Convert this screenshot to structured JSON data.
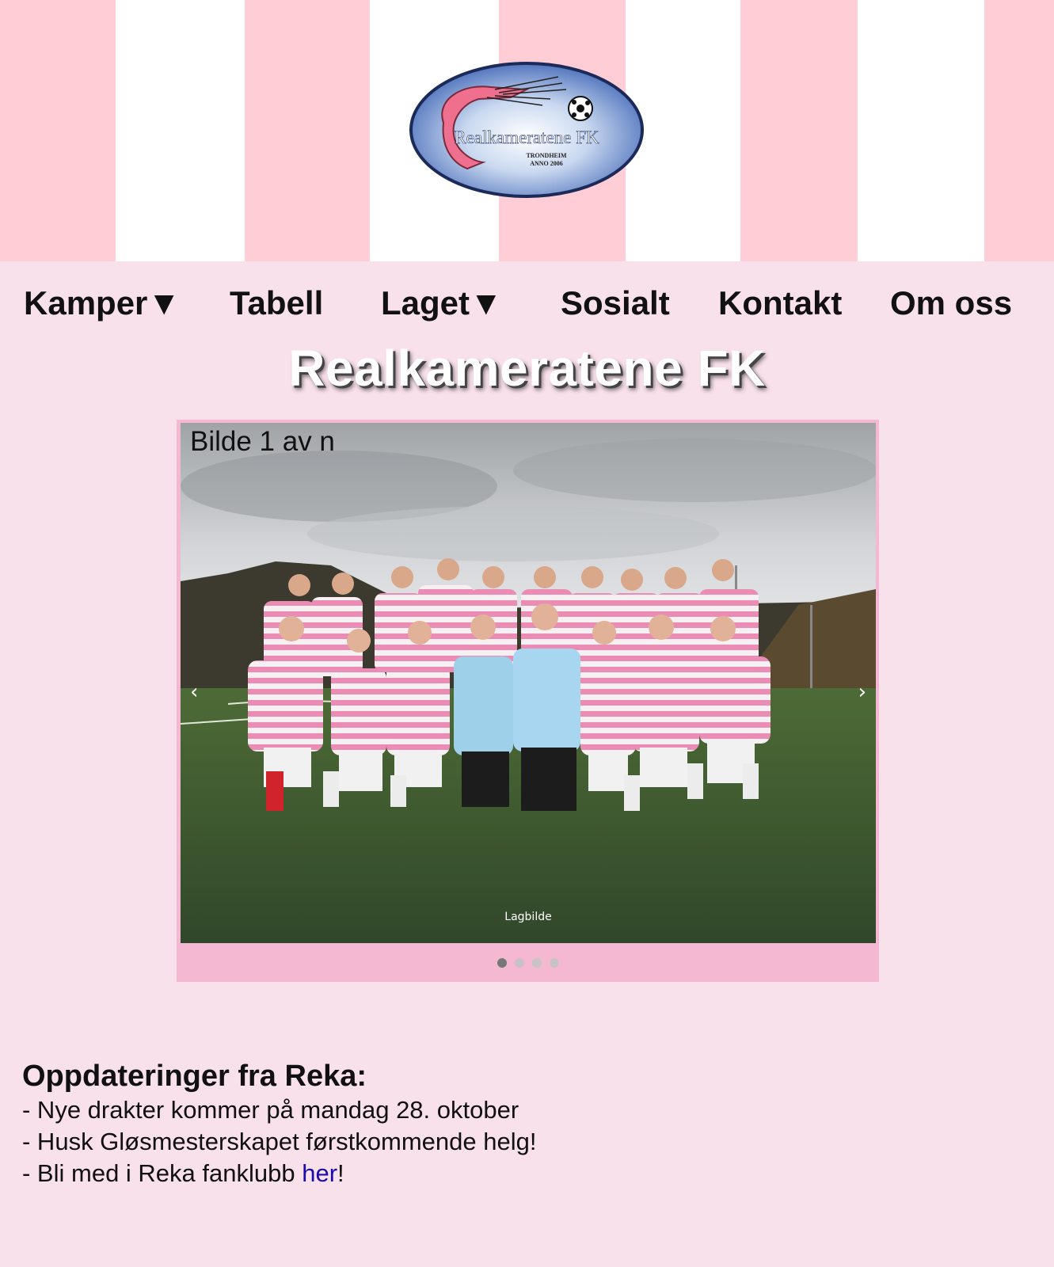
{
  "header": {
    "logo": {
      "name": "Realkameratene FK",
      "city": "TRONDHEIM",
      "founded": "ANNO 2006"
    },
    "stripe_color": "#fecdd6"
  },
  "nav": {
    "items": [
      {
        "label": "Kamper▼"
      },
      {
        "label": "Tabell"
      },
      {
        "label": "Laget▼"
      },
      {
        "label": "Sosialt"
      },
      {
        "label": "Kontakt"
      },
      {
        "label": "Om oss"
      }
    ]
  },
  "title": "Realkameratene FK",
  "slideshow": {
    "counter": "Bilde 1 av n",
    "caption": "Lagbilde",
    "prev": "‹",
    "next": "›",
    "total_slides": 4,
    "active_slide": 1
  },
  "updates": {
    "heading": "Oppdateringer fra Reka:",
    "line1": "- Nye drakter kommer på mandag 28. oktober",
    "line2": "- Husk Gløsmesterskapet førstkommende helg!",
    "line3_prefix": "- Bli med i Reka fanklubb ",
    "line3_link": "her",
    "line3_suffix": "!"
  },
  "colors": {
    "background": "#f9e1ec",
    "slideshow_frame": "#f4b8d3",
    "link": "#1a0dab"
  }
}
